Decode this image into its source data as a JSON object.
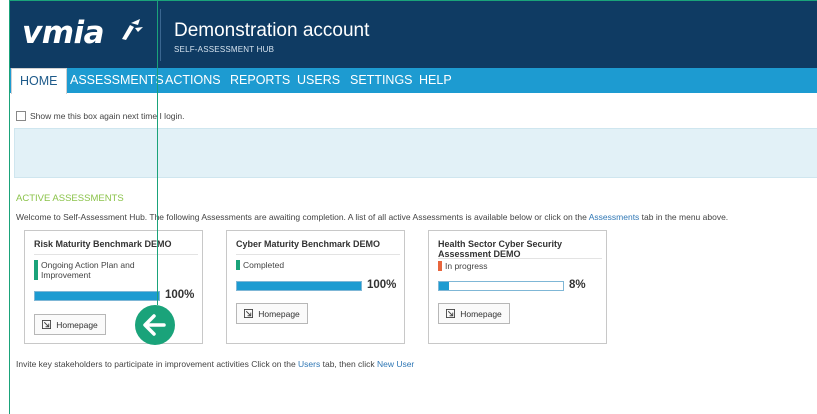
{
  "header": {
    "logo_text": "vmia",
    "account_title": "Demonstration account",
    "account_subtitle": "SELF-ASSESSMENT HUB",
    "bg_color": "#0f3b63"
  },
  "nav": {
    "items": [
      {
        "label": "HOME",
        "active": true
      },
      {
        "label": "ASSESSMENTS"
      },
      {
        "label": "ACTIONS"
      },
      {
        "label": "REPORTS"
      },
      {
        "label": "USERS"
      },
      {
        "label": "SETTINGS"
      },
      {
        "label": "HELP"
      }
    ],
    "bg_color": "#1d9bd1"
  },
  "showme": {
    "label": "Show me this box again next time I login.",
    "checked": false
  },
  "active": {
    "title": "ACTIVE ASSESSMENTS",
    "welcome_before": "Welcome to Self-Assessment Hub. The following Assessments are awaiting completion. A list of all active Assessments is available below or click on the ",
    "welcome_link": "Assessments",
    "welcome_after": " tab in the menu above."
  },
  "cards": [
    {
      "title": "Risk Maturity Benchmark DEMO",
      "status": "Ongoing Action Plan and Improvement",
      "status_color": "#1aa37a",
      "progress_pct": 100,
      "progress_label": "100%",
      "button": "Homepage"
    },
    {
      "title": "Cyber Maturity Benchmark DEMO",
      "status": "Completed",
      "status_color": "#1aa37a",
      "progress_pct": 100,
      "progress_label": "100%",
      "button": "Homepage"
    },
    {
      "title": "Health Sector Cyber Security Assessment DEMO",
      "status": "In progress",
      "status_color": "#e8663d",
      "progress_pct": 8,
      "progress_label": "8%",
      "button": "Homepage"
    }
  ],
  "invite": {
    "before": "Invite key stakeholders to participate in improvement activities Click on the ",
    "users_link": "Users",
    "middle": " tab, then click ",
    "new_user_link": "New User"
  },
  "back_button": {
    "icon": "arrow-left-icon",
    "color": "#1aa37a"
  }
}
